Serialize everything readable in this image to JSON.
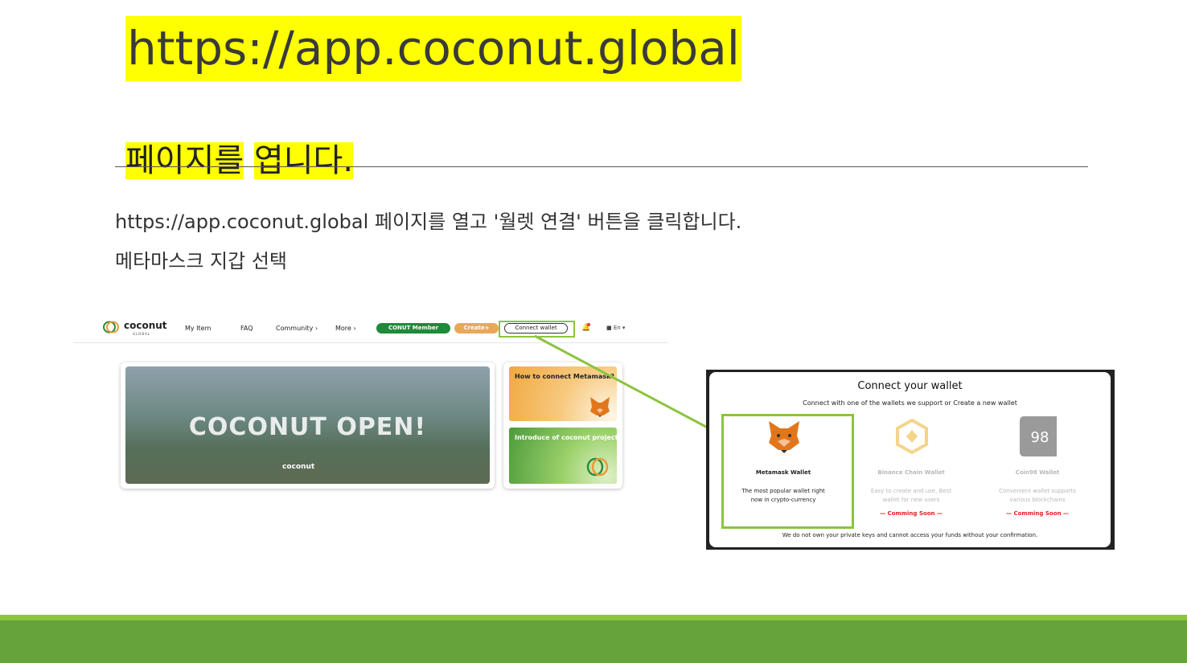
{
  "slide": {
    "url_title": "https://app.coconut.global",
    "heading_part1": "페이지를",
    "heading_part2": "엽니다.",
    "para1": "https://app.coconut.global 페이지를 열고 '월렛 연결' 버튼을 클릭합니다.",
    "para2": "메타마스크 지갑 선택",
    "highlight_color": "#ffff00",
    "accent_color": "#8cc43f",
    "footer_color": "#66a33a"
  },
  "site": {
    "logo_text": "coconut",
    "logo_sub": "GLOBAL",
    "nav": [
      "My Item",
      "FAQ",
      "Community ›",
      "More ›"
    ],
    "member_button": "CONUT Member",
    "create_button": "Create+",
    "connect_button": "Connect wallet",
    "language": "En",
    "hero_title": "COCONUT OPEN!",
    "hero_logo": "coconut",
    "card1_title": "How to connect Metamask?",
    "card2_title": "Introduce of coconut project"
  },
  "modal": {
    "title": "Connect your wallet",
    "subtitle": "Connect with one of the wallets we support or Create a new wallet",
    "wallets": [
      {
        "name": "Metamask Wallet",
        "desc": "The most popular wallet right now in crypto-currency",
        "soon": "",
        "icon": "metamask-fox-icon"
      },
      {
        "name": "Binance Chain Wallet",
        "desc": "Easy to create and use, Best wallet for new users",
        "soon": "— Comming Soon —",
        "icon": "binance-icon"
      },
      {
        "name": "Coin98 Wallet",
        "desc": "Convenient wallet supports various blockchains",
        "soon": "— Comming Soon —",
        "icon": "coin98-icon"
      }
    ],
    "footer": "We do not own your private keys and cannot access your funds without your confirmation."
  }
}
